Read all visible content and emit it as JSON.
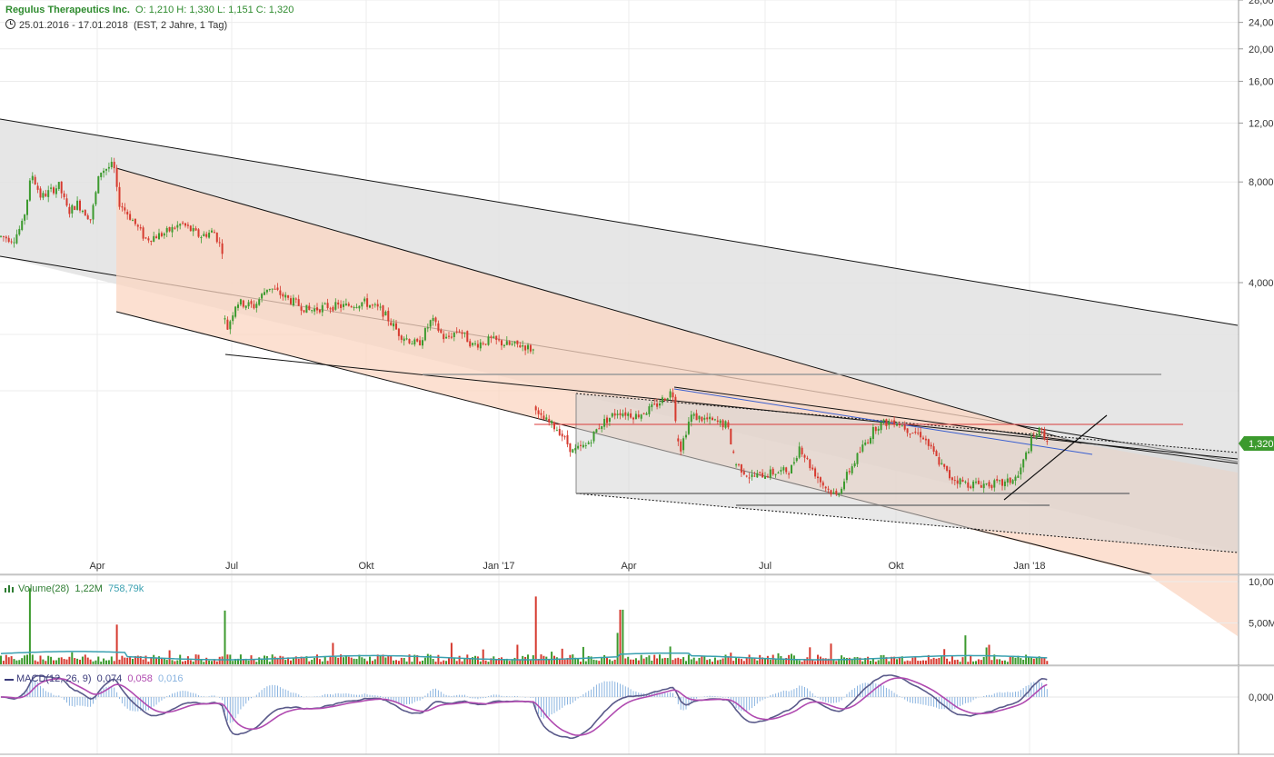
{
  "header": {
    "title": "Regulus Therapeutics Inc.",
    "ohlc": "O: 1,210  H: 1,330  L: 1,151  C: 1,320",
    "range": "25.01.2016 - 17.01.2018",
    "range_detail": "(EST, 2 Jahre, 1 Tag)"
  },
  "price_tag": "1,320",
  "colors": {
    "up": "#3c9a2e",
    "down": "#d63a2f",
    "grey_channel": "#e3e3e3",
    "salmon_channel": "#fbdccc",
    "blue_line": "#3a5fd0",
    "red_line": "#d83a3a",
    "macd_line": "#5a5a8a",
    "signal_line": "#b04ab0",
    "hist": "#8ab4e0",
    "vol_avg": "#3aa0b0"
  },
  "chart_data": {
    "type": "candlestick",
    "x_ticks": [
      "Apr",
      "Jul",
      "Okt",
      "Jan '17",
      "Apr",
      "Jul",
      "Okt",
      "Jan '18"
    ],
    "y_scale": "log",
    "y_ticks": [
      "28,00",
      "24,00",
      "20,00",
      "16,00",
      "12,00",
      "8,000",
      "4,000"
    ],
    "y_tick_values": [
      28,
      24,
      20,
      16,
      12,
      8,
      4
    ],
    "ylim": [
      1.2,
      30
    ],
    "last_close": 1.32,
    "price_path": [
      [
        0,
        5.5
      ],
      [
        15,
        5.4
      ],
      [
        25,
        6.0
      ],
      [
        35,
        8.5
      ],
      [
        45,
        7.2
      ],
      [
        55,
        7.5
      ],
      [
        65,
        7.8
      ],
      [
        75,
        6.5
      ],
      [
        85,
        6.9
      ],
      [
        100,
        6.2
      ],
      [
        110,
        8.6
      ],
      [
        125,
        9.0
      ],
      [
        130,
        7.0
      ],
      [
        145,
        6.2
      ],
      [
        160,
        5.4
      ],
      [
        180,
        5.6
      ],
      [
        200,
        6.0
      ],
      [
        220,
        5.5
      ],
      [
        235,
        5.7
      ],
      [
        245,
        5.0
      ],
      [
        248,
        2.8
      ],
      [
        260,
        3.5
      ],
      [
        280,
        3.4
      ],
      [
        295,
        3.9
      ],
      [
        315,
        3.6
      ],
      [
        340,
        3.3
      ],
      [
        360,
        3.4
      ],
      [
        380,
        3.4
      ],
      [
        400,
        3.5
      ],
      [
        420,
        3.3
      ],
      [
        440,
        2.8
      ],
      [
        460,
        2.6
      ],
      [
        475,
        3.1
      ],
      [
        490,
        2.7
      ],
      [
        505,
        2.9
      ],
      [
        520,
        2.6
      ],
      [
        540,
        2.7
      ],
      [
        560,
        2.6
      ],
      [
        575,
        2.6
      ],
      [
        588,
        2.5
      ],
      [
        590,
        1.6
      ],
      [
        600,
        1.55
      ],
      [
        615,
        1.45
      ],
      [
        630,
        1.25
      ],
      [
        645,
        1.3
      ],
      [
        660,
        1.5
      ],
      [
        680,
        1.65
      ],
      [
        700,
        1.6
      ],
      [
        720,
        1.7
      ],
      [
        740,
        1.9
      ],
      [
        748,
        1.25
      ],
      [
        760,
        1.6
      ],
      [
        780,
        1.55
      ],
      [
        800,
        1.5
      ],
      [
        810,
        1.15
      ],
      [
        825,
        1.05
      ],
      [
        850,
        1.08
      ],
      [
        870,
        1.1
      ],
      [
        880,
        1.3
      ],
      [
        890,
        1.15
      ],
      [
        905,
        1.0
      ],
      [
        920,
        0.92
      ],
      [
        935,
        1.1
      ],
      [
        950,
        1.3
      ],
      [
        965,
        1.5
      ],
      [
        985,
        1.55
      ],
      [
        1000,
        1.45
      ],
      [
        1015,
        1.4
      ],
      [
        1030,
        1.2
      ],
      [
        1045,
        1.05
      ],
      [
        1065,
        1.0
      ],
      [
        1085,
        1.0
      ],
      [
        1105,
        1.0
      ],
      [
        1120,
        1.05
      ],
      [
        1135,
        1.35
      ],
      [
        1145,
        1.45
      ],
      [
        1155,
        1.32
      ]
    ],
    "volume": {
      "label": "Volume(28)",
      "value1": "1,22M",
      "value2": "758,79k",
      "y_ticks": [
        "10,00M",
        "5,00M"
      ],
      "y_tick_values": [
        10,
        5
      ],
      "ylim": [
        0,
        10
      ],
      "spikes": [
        {
          "x": 34,
          "value": 9.2
        },
        {
          "x": 128,
          "value": 4.8
        },
        {
          "x": 247,
          "value": 6.5
        },
        {
          "x": 590,
          "value": 8.2
        },
        {
          "x": 684,
          "value": 6.6
        },
        {
          "x": 680,
          "value": 3.8
        },
        {
          "x": 1063,
          "value": 3.5
        }
      ]
    },
    "macd": {
      "label": "MACD(12, 26, 9)",
      "macd_value": "0,074",
      "signal_value": "0,058",
      "hist_value": "0,016",
      "y_ticks": [
        "0,000"
      ]
    }
  }
}
